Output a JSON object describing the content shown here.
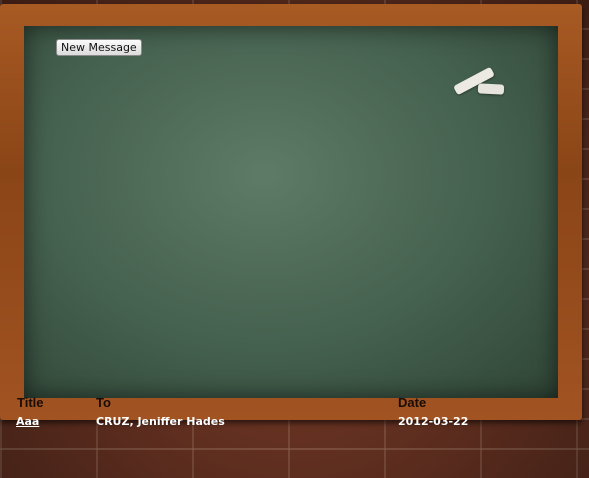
{
  "toolbar": {
    "new_message_label": "New Message"
  },
  "table": {
    "columns": [
      "Title",
      "To",
      "Date"
    ],
    "rows": [
      {
        "title": "Aaa",
        "to": "CRUZ, Jeniffer Hades",
        "date": "2012-03-22"
      }
    ]
  }
}
